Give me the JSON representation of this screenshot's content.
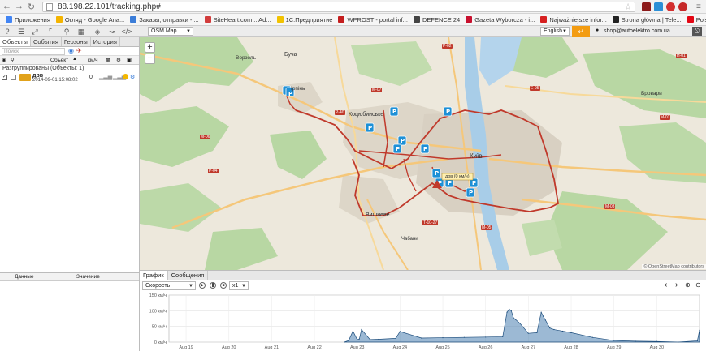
{
  "browser": {
    "url": "88.198.22.101/tracking.php#",
    "bookmarks": [
      {
        "label": "Приложения",
        "color": "#4285f4"
      },
      {
        "label": "Огляд - Google Ana...",
        "color": "#f4b400"
      },
      {
        "label": "Заказы, отправки - ...",
        "color": "#3b7dd8"
      },
      {
        "label": "SiteHeart.com :: Ad...",
        "color": "#d23c3c"
      },
      {
        "label": "1С:Предприятие",
        "color": "#f2c200"
      },
      {
        "label": "WPROST - portal inf...",
        "color": "#c41e1e"
      },
      {
        "label": "DEFENCE 24",
        "color": "#444444"
      },
      {
        "label": "Gazeta Wyborcza - i...",
        "color": "#c8102e"
      },
      {
        "label": "Najważniejsze infor...",
        "color": "#d62020"
      },
      {
        "label": "Strona główna | Tele...",
        "color": "#222222"
      },
      {
        "label": "Polskie Radio - najle...",
        "color": "#e30613"
      }
    ]
  },
  "toolbar": {
    "map_layer": "OSM Map",
    "language": "English",
    "user": "shop@autoelektro.com.ua"
  },
  "left_panel": {
    "tabs": [
      "Объекты",
      "События",
      "Геозоны",
      "История"
    ],
    "search_placeholder": "Поиск",
    "column_object": "Объект",
    "column_speed": "км/ч",
    "group_label": "Разгруппированы (Объекты: 1)",
    "object": {
      "name": "дрв",
      "datetime": "2014-09-01 15:08:02",
      "speed": "0"
    },
    "data_col": "Данные",
    "value_col": "Значение"
  },
  "map": {
    "city_labels": [
      {
        "text": "Буча"
      },
      {
        "text": "Ворзель"
      },
      {
        "text": "Ірпінь"
      },
      {
        "text": "Коцюбинське"
      },
      {
        "text": "Київ"
      },
      {
        "text": "Вишневе"
      },
      {
        "text": "Чабани"
      },
      {
        "text": "Бровари"
      }
    ],
    "road_labels": [
      "P-02",
      "M-07",
      "M-06",
      "P-04",
      "M-05",
      "M-03",
      "H-01",
      "E-95",
      "P-40",
      "M-01",
      "T-10-27"
    ],
    "marker_label": "дрв (0 км/ч)",
    "attribution": "© OpenStreetMap contributors",
    "zoom_in": "+",
    "zoom_out": "−"
  },
  "bottom_panel": {
    "tabs": [
      "График",
      "Сообщения"
    ],
    "metric": "Скорость",
    "playback_speed": "x1"
  },
  "chart_data": {
    "type": "area",
    "ylabel": "км/ч",
    "y_ticks": [
      "150 км/ч",
      "100 км/ч",
      "50 км/ч",
      "0 км/ч"
    ],
    "ylim": [
      0,
      150
    ],
    "x_ticks": [
      "Aug 19",
      "Aug 20",
      "Aug 21",
      "Aug 22",
      "Aug 23",
      "Aug 24",
      "Aug 25",
      "Aug 26",
      "Aug 27",
      "Aug 28",
      "Aug 29",
      "Aug 30"
    ],
    "x": [
      22.7,
      22.8,
      22.9,
      23.0,
      23.05,
      23.1,
      23.3,
      23.5,
      23.9,
      24.0,
      24.5,
      25.0,
      25.5,
      26.0,
      26.4,
      26.5,
      26.55,
      26.6,
      26.65,
      26.7,
      26.8,
      27.0,
      27.2,
      27.3,
      27.35,
      27.4,
      27.5,
      27.6,
      27.8,
      28.0,
      28.5,
      29.0,
      29.5,
      30.0,
      30.5,
      30.95,
      31.0
    ],
    "values": [
      0,
      5,
      35,
      8,
      10,
      40,
      8,
      9,
      12,
      34,
      13,
      14,
      15,
      16,
      17,
      95,
      105,
      100,
      78,
      72,
      60,
      28,
      30,
      95,
      82,
      70,
      45,
      40,
      35,
      30,
      15,
      5,
      3,
      2,
      0,
      4,
      38
    ]
  },
  "colors": {
    "route": "#c0392b",
    "marker": "#1e90d6",
    "chart_fill": "#4b7fb0",
    "chart_line": "#1f4f7e",
    "forest": "#b8d7a3",
    "urban": "#dcd6cc",
    "water": "#a8cde8"
  }
}
